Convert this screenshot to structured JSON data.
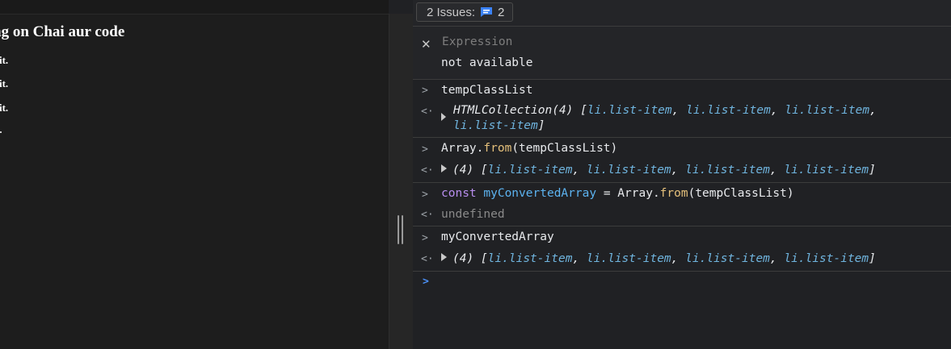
{
  "page": {
    "heading": "ng on Chai aur code",
    "lines": [
      "lor sit.",
      "lor sit.",
      "lor sit."
    ]
  },
  "issues": {
    "label": "2 Issues:",
    "count": "2",
    "icon": "chat-message-icon"
  },
  "live_expression": {
    "placeholder": "Expression",
    "value": "not available"
  },
  "console": {
    "entries": [
      {
        "input": "tempClassList",
        "output": {
          "type": "HTMLCollection(4)",
          "items": [
            "li.list-item",
            "li.list-item",
            "li.list-item",
            "li.list-item"
          ]
        }
      },
      {
        "input": {
          "object": "Array",
          "method": "from",
          "arg": "tempClassList"
        },
        "output": {
          "type": "(4)",
          "items": [
            "li.list-item",
            "li.list-item",
            "li.list-item",
            "li.list-item"
          ]
        }
      },
      {
        "input": {
          "keyword": "const",
          "name": "myConvertedArray",
          "operator": "=",
          "object": "Array",
          "method": "from",
          "arg": "tempClassList"
        },
        "output": {
          "text": "undefined"
        }
      },
      {
        "input": "myConvertedArray",
        "output": {
          "type": "(4)",
          "items": [
            "li.list-item",
            "li.list-item",
            "li.list-item",
            "li.list-item"
          ]
        }
      }
    ]
  },
  "colors": {
    "keyword": "#b98ff0",
    "variable": "#5cb3f0",
    "method": "#e5c07b",
    "class_name": "#6fb4de",
    "prompt_caret": "#4b8ff5",
    "background": "#202124"
  }
}
